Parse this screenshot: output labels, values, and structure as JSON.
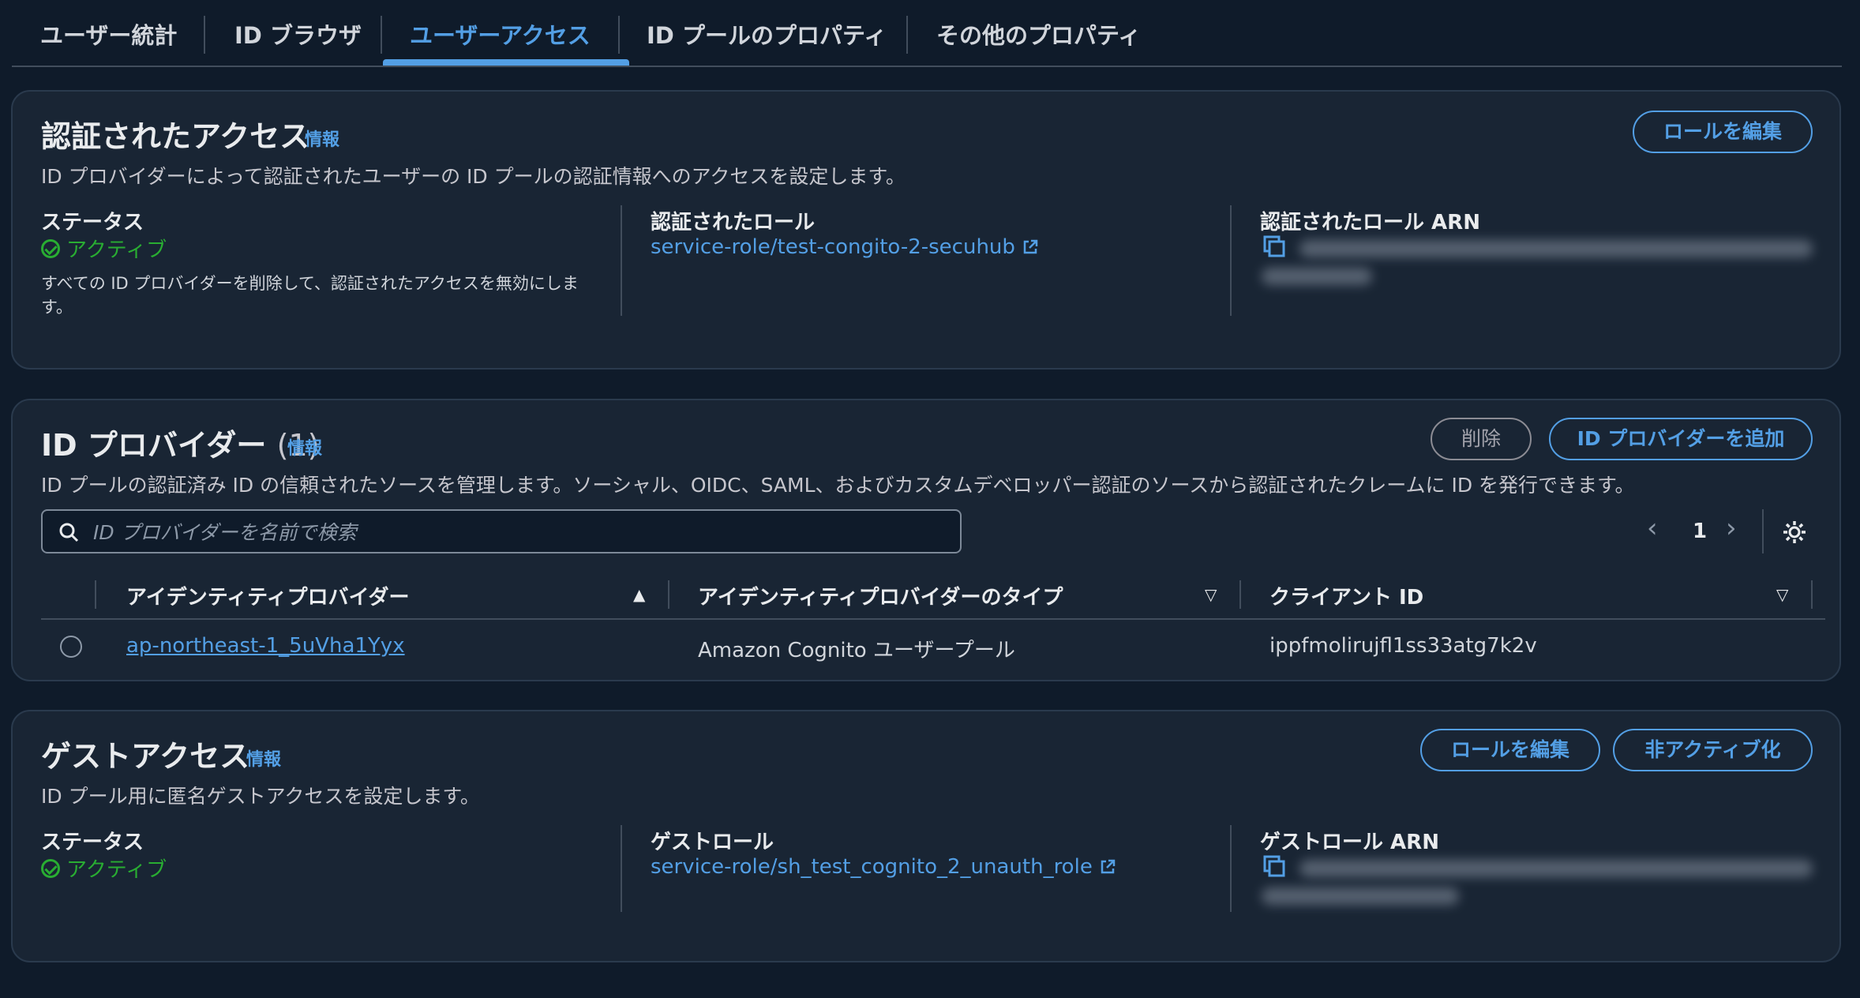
{
  "tabs": [
    {
      "label": "ユーザー統計"
    },
    {
      "label": "ID ブラウザ"
    },
    {
      "label": "ユーザーアクセス"
    },
    {
      "label": "ID プールのプロパティ"
    },
    {
      "label": "その他のプロパティ"
    }
  ],
  "active_tab": "ユーザーアクセス",
  "auth_access": {
    "title": "認証されたアクセス",
    "info": "情報",
    "description": "ID プロバイダーによって認証されたユーザーの ID プールの認証情報へのアクセスを設定します。",
    "edit_role_button": "ロールを編集",
    "status_label": "ステータス",
    "status_value": "アクティブ",
    "status_note": "すべての ID プロバイダーを削除して、認証されたアクセスを無効にします。",
    "role_label": "認証されたロール",
    "role_link": "service-role/test-congito-2-secuhub",
    "arn_label": "認証されたロール ARN"
  },
  "id_providers": {
    "title": "ID プロバイダー",
    "count": "(1)",
    "info": "情報",
    "description": "ID プールの認証済み ID の信頼されたソースを管理します。ソーシャル、OIDC、SAML、およびカスタムデベロッパー認証のソースから認証されたクレームに ID を発行できます。",
    "delete_button": "削除",
    "add_button": "ID プロバイダーを追加",
    "search_placeholder": "ID プロバイダーを名前で検索",
    "page": "1",
    "columns": [
      "アイデンティティプロバイダー",
      "アイデンティティプロバイダーのタイプ",
      "クライアント ID"
    ],
    "rows": [
      {
        "provider": "ap-northeast-1_5uVha1Yyx",
        "type": "Amazon Cognito ユーザープール",
        "client_id": "ippfmolirujfl1ss33atg7k2v"
      }
    ]
  },
  "guest_access": {
    "title": "ゲストアクセス",
    "info": "情報",
    "description": "ID プール用に匿名ゲストアクセスを設定します。",
    "edit_role_button": "ロールを編集",
    "deactivate_button": "非アクティブ化",
    "status_label": "ステータス",
    "status_value": "アクティブ",
    "role_label": "ゲストロール",
    "role_link": "service-role/sh_test_cognito_2_unauth_role",
    "arn_label": "ゲストロール ARN"
  },
  "colors": {
    "background": "#0f1b2a",
    "panel": "#192534",
    "accent": "#539fe5",
    "success": "#29ad32"
  }
}
